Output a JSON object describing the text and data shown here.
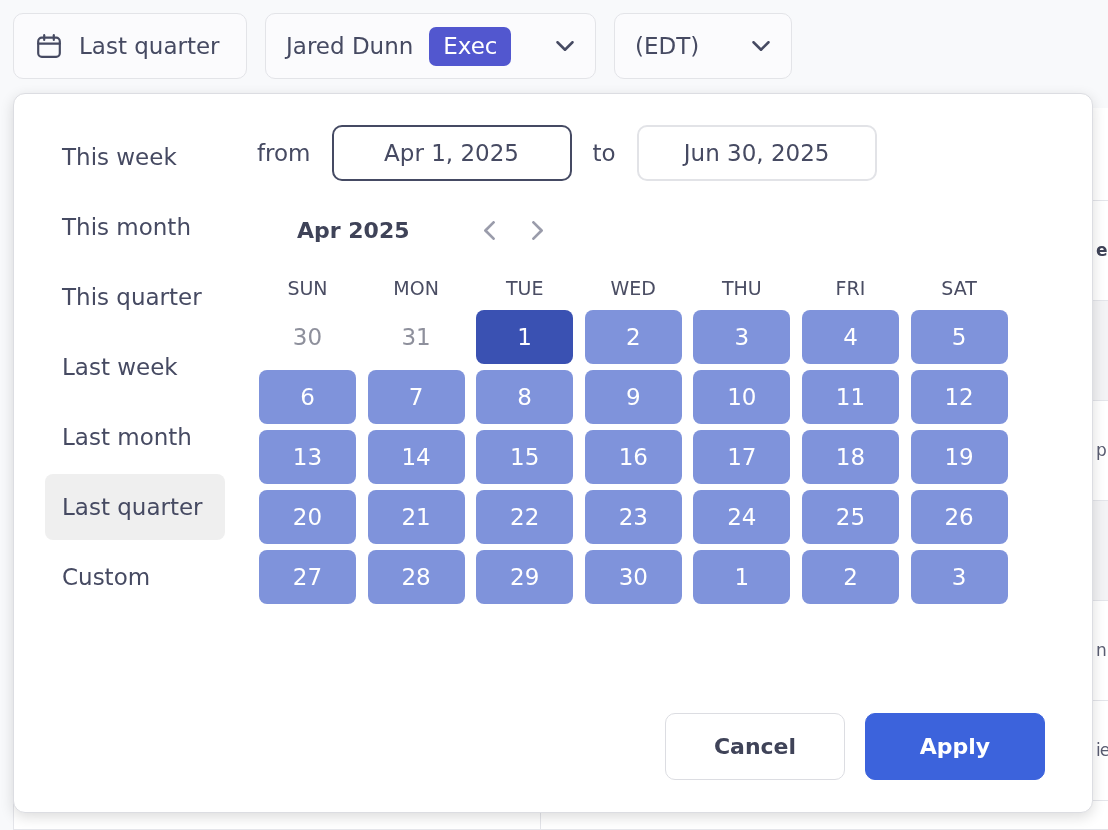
{
  "toolbar": {
    "date_range": {
      "label": "Last quarter"
    },
    "user": {
      "name": "Jared Dunn",
      "badge": "Exec"
    },
    "timezone": {
      "label": "(EDT)"
    }
  },
  "table": {
    "rows": [
      {
        "shaded": false
      },
      {
        "shaded": false,
        "cell": {
          "kind": "header",
          "text": "e"
        }
      },
      {
        "shaded": true
      },
      {
        "shaded": false,
        "cell": {
          "kind": "body",
          "text": "p"
        }
      },
      {
        "shaded": true
      },
      {
        "shaded": false,
        "cell": {
          "kind": "body",
          "text": "n"
        }
      },
      {
        "shaded": false,
        "cell": {
          "kind": "body",
          "text": "ie"
        }
      },
      {
        "shaded": false
      }
    ]
  },
  "date_picker": {
    "presets": [
      {
        "label": "This week",
        "selected": false
      },
      {
        "label": "This month",
        "selected": false
      },
      {
        "label": "This quarter",
        "selected": false
      },
      {
        "label": "Last week",
        "selected": false
      },
      {
        "label": "Last month",
        "selected": false
      },
      {
        "label": "Last quarter",
        "selected": true
      },
      {
        "label": "Custom",
        "selected": false
      }
    ],
    "range": {
      "from": {
        "label": "from",
        "value": "Apr 1, 2025",
        "focused": true
      },
      "to": {
        "label": "to",
        "value": "Jun 30, 2025",
        "focused": false
      }
    },
    "calendar": {
      "month": "Apr 2025",
      "weekdays": [
        "SUN",
        "MON",
        "TUE",
        "WED",
        "THU",
        "FRI",
        "SAT"
      ],
      "weeks": [
        {
          "days": [
            {
              "label": "30",
              "selected": false,
              "in_range": false
            },
            {
              "label": "31",
              "selected": false,
              "in_range": false
            },
            {
              "label": "1",
              "selected": true,
              "in_range": true
            },
            {
              "label": "2",
              "selected": false,
              "in_range": true
            },
            {
              "label": "3",
              "selected": false,
              "in_range": true
            },
            {
              "label": "4",
              "selected": false,
              "in_range": true
            },
            {
              "label": "5",
              "selected": false,
              "in_range": true
            }
          ]
        },
        {
          "days": [
            {
              "label": "6",
              "selected": false,
              "in_range": true
            },
            {
              "label": "7",
              "selected": false,
              "in_range": true
            },
            {
              "label": "8",
              "selected": false,
              "in_range": true
            },
            {
              "label": "9",
              "selected": false,
              "in_range": true
            },
            {
              "label": "10",
              "selected": false,
              "in_range": true
            },
            {
              "label": "11",
              "selected": false,
              "in_range": true
            },
            {
              "label": "12",
              "selected": false,
              "in_range": true
            }
          ]
        },
        {
          "days": [
            {
              "label": "13",
              "selected": false,
              "in_range": true
            },
            {
              "label": "14",
              "selected": false,
              "in_range": true
            },
            {
              "label": "15",
              "selected": false,
              "in_range": true
            },
            {
              "label": "16",
              "selected": false,
              "in_range": true
            },
            {
              "label": "17",
              "selected": false,
              "in_range": true
            },
            {
              "label": "18",
              "selected": false,
              "in_range": true
            },
            {
              "label": "19",
              "selected": false,
              "in_range": true
            }
          ]
        },
        {
          "days": [
            {
              "label": "20",
              "selected": false,
              "in_range": true
            },
            {
              "label": "21",
              "selected": false,
              "in_range": true
            },
            {
              "label": "22",
              "selected": false,
              "in_range": true
            },
            {
              "label": "23",
              "selected": false,
              "in_range": true
            },
            {
              "label": "24",
              "selected": false,
              "in_range": true
            },
            {
              "label": "25",
              "selected": false,
              "in_range": true
            },
            {
              "label": "26",
              "selected": false,
              "in_range": true
            }
          ]
        },
        {
          "days": [
            {
              "label": "27",
              "selected": false,
              "in_range": true
            },
            {
              "label": "28",
              "selected": false,
              "in_range": true
            },
            {
              "label": "29",
              "selected": false,
              "in_range": true
            },
            {
              "label": "30",
              "selected": false,
              "in_range": true
            },
            {
              "label": "1",
              "selected": false,
              "in_range": true
            },
            {
              "label": "2",
              "selected": false,
              "in_range": true
            },
            {
              "label": "3",
              "selected": false,
              "in_range": true
            }
          ]
        }
      ]
    },
    "actions": [
      {
        "label": "Cancel",
        "kind": "secondary"
      },
      {
        "label": "Apply",
        "kind": "primary"
      }
    ]
  }
}
